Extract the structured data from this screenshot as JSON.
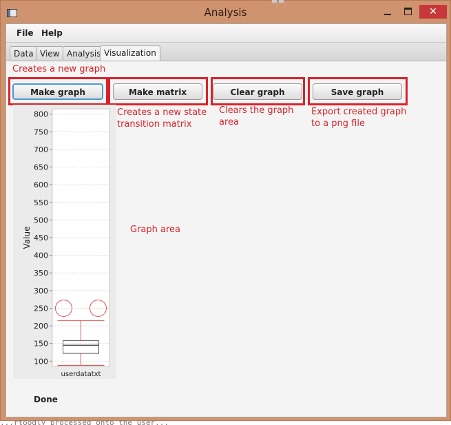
{
  "window": {
    "title": "Analysis",
    "close_glyph": "✕"
  },
  "menu": {
    "file": "File",
    "help": "Help"
  },
  "tabs": [
    {
      "label": "Data",
      "active": false
    },
    {
      "label": "View",
      "active": false
    },
    {
      "label": "Analysis",
      "active": false
    },
    {
      "label": "Visualization",
      "active": true
    }
  ],
  "buttons": {
    "make_graph": "Make graph",
    "make_matrix": "Make matrix",
    "clear_graph": "Clear graph",
    "save_graph": "Save graph"
  },
  "annotations": {
    "make_graph": "Creates a new graph",
    "make_matrix_line1": "Creates a new state",
    "make_matrix_line2": "transition matrix",
    "clear_graph_line1": "Clears the graph",
    "clear_graph_line2": "area",
    "save_graph_line1": "Export created graph",
    "save_graph_line2": "to a png file",
    "graph_area": "Graph area"
  },
  "status": "Done",
  "behind_text": "...rtoodly processed onto the user...",
  "colors": {
    "annotation_red": "#d9222a",
    "box_red": "#e85050",
    "focus_blue": "#4a9ad6",
    "window_frame": "#d0936f",
    "close_button": "#c7383a"
  },
  "chart_data": {
    "type": "box",
    "ylabel": "Value",
    "xlabel": "",
    "categories": [
      "userdatatxt"
    ],
    "ylim": [
      85,
      815
    ],
    "yticks": [
      100,
      150,
      200,
      250,
      300,
      350,
      400,
      450,
      500,
      550,
      600,
      650,
      700,
      750,
      800
    ],
    "grid": true,
    "boxes": [
      {
        "category": "userdatatxt",
        "whisker_low": 88,
        "q1": 122,
        "median": 145,
        "q3": 158,
        "whisker_high": 215,
        "outliers": [
          250,
          250
        ]
      }
    ]
  }
}
